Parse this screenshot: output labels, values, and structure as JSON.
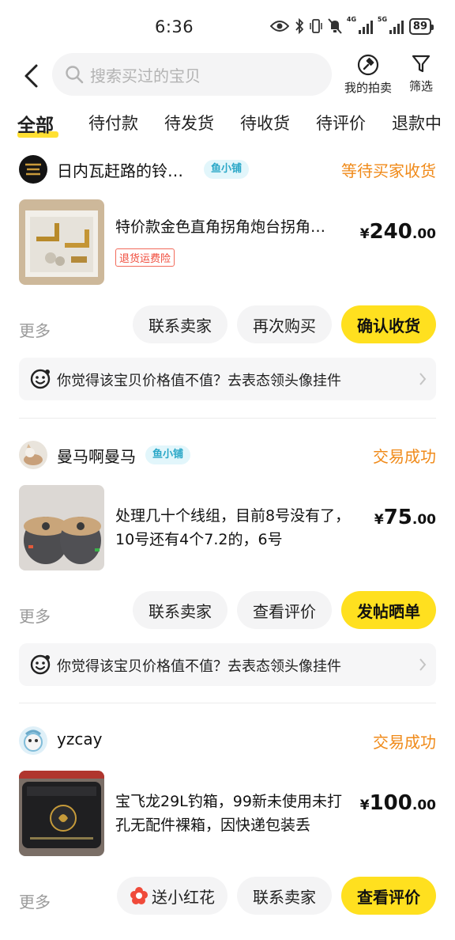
{
  "status_bar": {
    "time": "6:36",
    "battery": "89",
    "net1": "4G",
    "net2": "5G",
    "icons": [
      "eye-icon",
      "bluetooth-icon",
      "vibrate-icon",
      "mute-bell-icon",
      "signal-4g-icon",
      "signal-5g-icon",
      "battery-icon"
    ]
  },
  "header": {
    "search_placeholder": "搜索买过的宝贝",
    "auction_label": "我的拍卖",
    "filter_label": "筛选"
  },
  "tabs": [
    "全部",
    "待付款",
    "待发货",
    "待收货",
    "待评价",
    "退款中"
  ],
  "active_tab": 0,
  "colors": {
    "accent_yellow": "#ffe01f",
    "status_orange": "#f08a19",
    "badge_blue": "#2aa7c7"
  },
  "orders": [
    {
      "shop_name": "日内瓦赶路的铃…",
      "shop_badge": "鱼小铺",
      "status": "等待买家收货",
      "product_title": "特价款金色直角拐角炮台拐角…",
      "tag": "退货运费险",
      "price_currency": "¥",
      "price_int": "240",
      "price_dec": ".00",
      "more_label": "更多",
      "buttons": [
        "联系卖家",
        "再次购买",
        "确认收货"
      ],
      "promo_text": "你觉得该宝贝价格值不值？去表态领头像挂件"
    },
    {
      "shop_name": "曼马啊曼马",
      "shop_badge": "鱼小铺",
      "status": "交易成功",
      "product_title": "处理几十个线组，目前8号没有了，10号还有4个7.2的，6号",
      "price_currency": "¥",
      "price_int": "75",
      "price_dec": ".00",
      "more_label": "更多",
      "buttons": [
        "联系卖家",
        "查看评价",
        "发帖晒单"
      ],
      "promo_text": "你觉得该宝贝价格值不值？去表态领头像挂件"
    },
    {
      "shop_name": "yzcay",
      "status": "交易成功",
      "product_title": "宝飞龙29L钓箱，99新未使用未打孔无配件裸箱，因快递包装丢",
      "price_currency": "¥",
      "price_int": "100",
      "price_dec": ".00",
      "more_label": "更多",
      "buttons": [
        "送小红花",
        "联系卖家",
        "查看评价"
      ]
    }
  ]
}
